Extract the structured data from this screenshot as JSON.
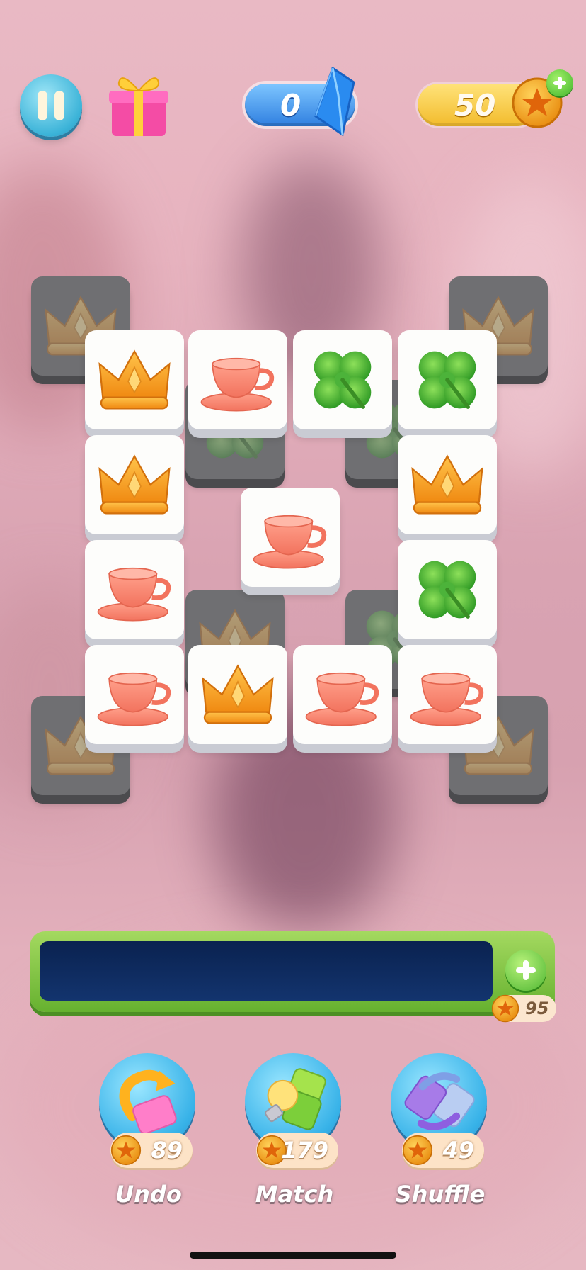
{
  "topbar": {
    "gems": "0",
    "coins": "50"
  },
  "tiles": [
    {
      "icon": "crown-icon",
      "layer": "lower"
    },
    {
      "icon": "clover-icon",
      "layer": "lower"
    },
    {
      "icon": "clover-icon",
      "layer": "lower"
    },
    {
      "icon": "crown-icon",
      "layer": "lower"
    },
    {
      "icon": "crown-icon",
      "layer": "lower"
    },
    {
      "icon": "clover-icon",
      "layer": "lower"
    },
    {
      "icon": "crown-icon",
      "layer": "lower"
    },
    {
      "icon": "crown-icon",
      "layer": "lower"
    },
    {
      "icon": "crown-icon",
      "layer": "top"
    },
    {
      "icon": "teacup-icon",
      "layer": "top"
    },
    {
      "icon": "clover-icon",
      "layer": "top"
    },
    {
      "icon": "clover-icon",
      "layer": "top"
    },
    {
      "icon": "crown-icon",
      "layer": "top"
    },
    {
      "icon": "crown-icon",
      "layer": "top"
    },
    {
      "icon": "teacup-icon",
      "layer": "top"
    },
    {
      "icon": "teacup-icon",
      "layer": "top"
    },
    {
      "icon": "clover-icon",
      "layer": "top"
    },
    {
      "icon": "teacup-icon",
      "layer": "top"
    },
    {
      "icon": "crown-icon",
      "layer": "top"
    },
    {
      "icon": "teacup-icon",
      "layer": "top"
    },
    {
      "icon": "teacup-icon",
      "layer": "top"
    }
  ],
  "tray": {
    "extend_cost": "95"
  },
  "boosters": {
    "undo": {
      "label": "Undo",
      "cost": "89"
    },
    "match": {
      "label": "Match",
      "cost": "179"
    },
    "shuffle": {
      "label": "Shuffle",
      "cost": "49"
    }
  },
  "colors": {
    "tray_frame": "#7cc13f",
    "tray_slot": "#0f2b60",
    "booster_blue": "#37b2e8",
    "coin_gold": "#f6a21c"
  }
}
